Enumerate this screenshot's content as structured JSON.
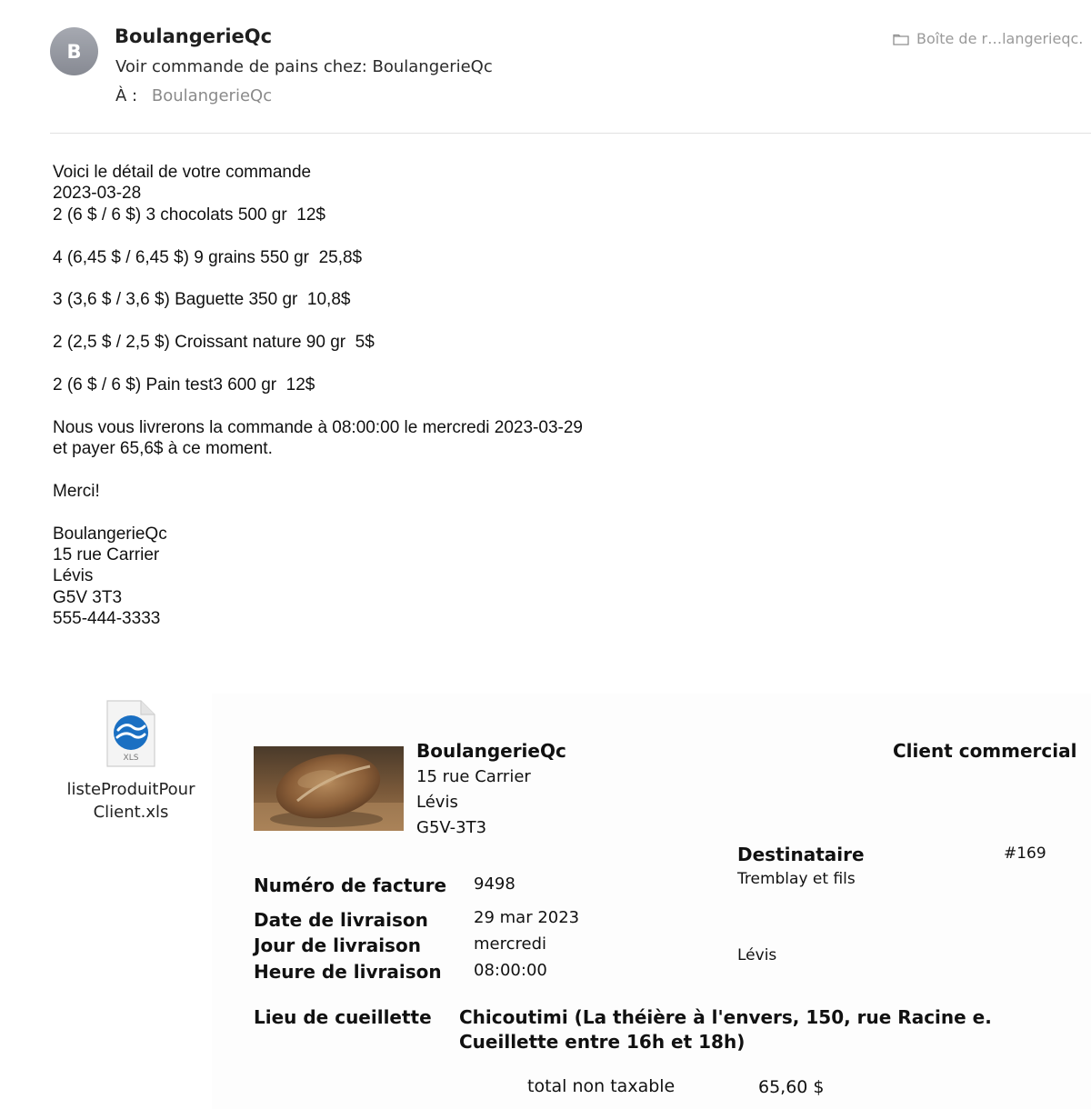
{
  "header": {
    "avatar_letter": "B",
    "sender": "BoulangerieQc",
    "subject": "Voir commande de pains chez: BoulangerieQc",
    "to_label": "À :",
    "to_value": "BoulangerieQc",
    "mailbox": "Boîte de r…langerieqc.",
    "mailbox_icon": "folder-icon"
  },
  "body_lines": [
    "Voici le détail de votre commande",
    "2023-03-28",
    "2 (6 $ / 6 $) 3 chocolats 500 gr  12$",
    "",
    "4 (6,45 $ / 6,45 $) 9 grains 550 gr  25,8$",
    "",
    "3 (3,6 $ / 3,6 $) Baguette 350 gr  10,8$",
    "",
    "2 (2,5 $ / 2,5 $) Croissant nature 90 gr  5$",
    "",
    "2 (6 $ / 6 $) Pain test3 600 gr  12$",
    "",
    "Nous vous livrerons la commande à 08:00:00 le mercredi 2023-03-29",
    "et payer 65,6$ à ce moment.",
    "",
    "Merci!",
    "",
    "BoulangerieQc",
    "15 rue Carrier",
    "Lévis",
    "G5V 3T3",
    "555-444-3333"
  ],
  "attachment": {
    "file_type": "XLS",
    "name_line1": "listeProduitPour",
    "name_line2": "Client.xls"
  },
  "invoice": {
    "company_name": "BoulangerieQc",
    "company_street": "15 rue Carrier",
    "company_city": "Lévis",
    "company_postal": "G5V-3T3",
    "client_type": "Client commercial",
    "recipient_label": "Destinataire",
    "recipient_number": "#169",
    "recipient_name": "Tremblay et fils",
    "recipient_city": "Lévis",
    "invoice_number_label": "Numéro de facture",
    "invoice_number": "9498",
    "delivery_date_label": "Date de livraison",
    "delivery_date": "29 mar 2023",
    "delivery_day_label": "Jour de livraison",
    "delivery_day": "mercredi",
    "delivery_time_label": "Heure de livraison",
    "delivery_time": "08:00:00",
    "pickup_label": "Lieu de cueillette",
    "pickup_line1": "Chicoutimi (La théière à l'envers, 150, rue Racine e.",
    "pickup_line2": "Cueillette entre 16h et 18h)",
    "total_label": "total non taxable",
    "total_value": "65,60 $"
  }
}
